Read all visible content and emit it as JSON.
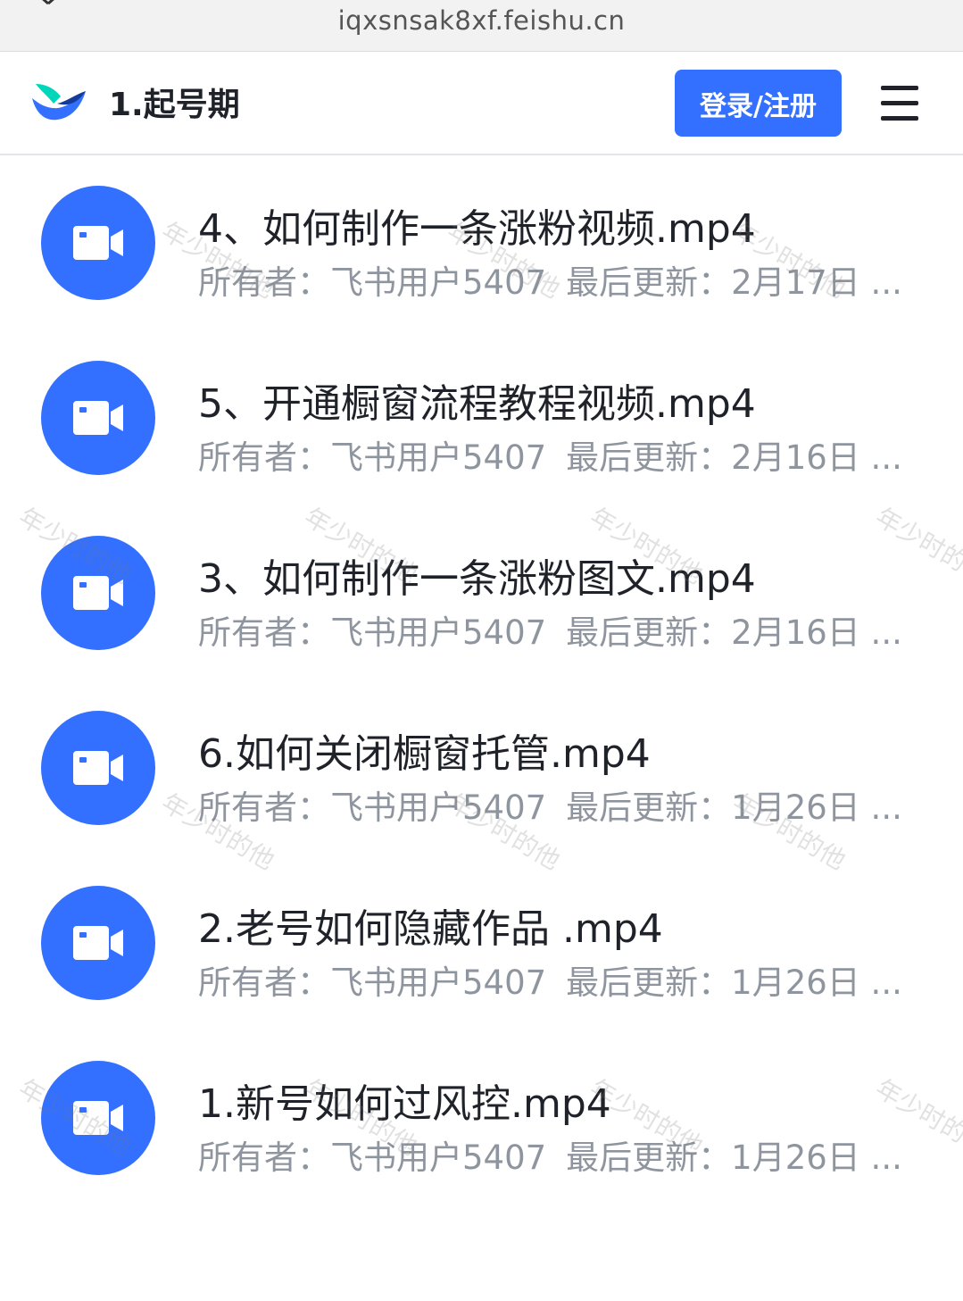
{
  "browser": {
    "url": "iqxsnsak8xf.feishu.cn"
  },
  "header": {
    "title": "1.起号期",
    "login_label": "登录/注册"
  },
  "files": [
    {
      "name": "4、如何制作一条涨粉视频.mp4",
      "owner": "所有者：飞书用户5407",
      "updated": "最后更新：2月17日 ..."
    },
    {
      "name": "5、开通橱窗流程教程视频.mp4",
      "owner": "所有者：飞书用户5407",
      "updated": "最后更新：2月16日 ..."
    },
    {
      "name": "3、如何制作一条涨粉图文.mp4",
      "owner": "所有者：飞书用户5407",
      "updated": "最后更新：2月16日 ..."
    },
    {
      "name": "6.如何关闭橱窗托管.mp4",
      "owner": "所有者：飞书用户5407",
      "updated": "最后更新：1月26日 ..."
    },
    {
      "name": "2.老号如何隐藏作品 .mp4",
      "owner": "所有者：飞书用户5407",
      "updated": "最后更新：1月26日 ..."
    },
    {
      "name": "1.新号如何过风控.mp4",
      "owner": "所有者：飞书用户5407",
      "updated": "最后更新：1月26日 ..."
    }
  ],
  "watermark": "年少时的他",
  "colors": {
    "accent": "#3370ff",
    "text": "#1f2329",
    "muted": "#8f959e"
  },
  "icons": {
    "file": "video-file-icon",
    "menu": "hamburger-menu-icon",
    "close": "close-icon",
    "logo": "feishu-logo-icon"
  }
}
